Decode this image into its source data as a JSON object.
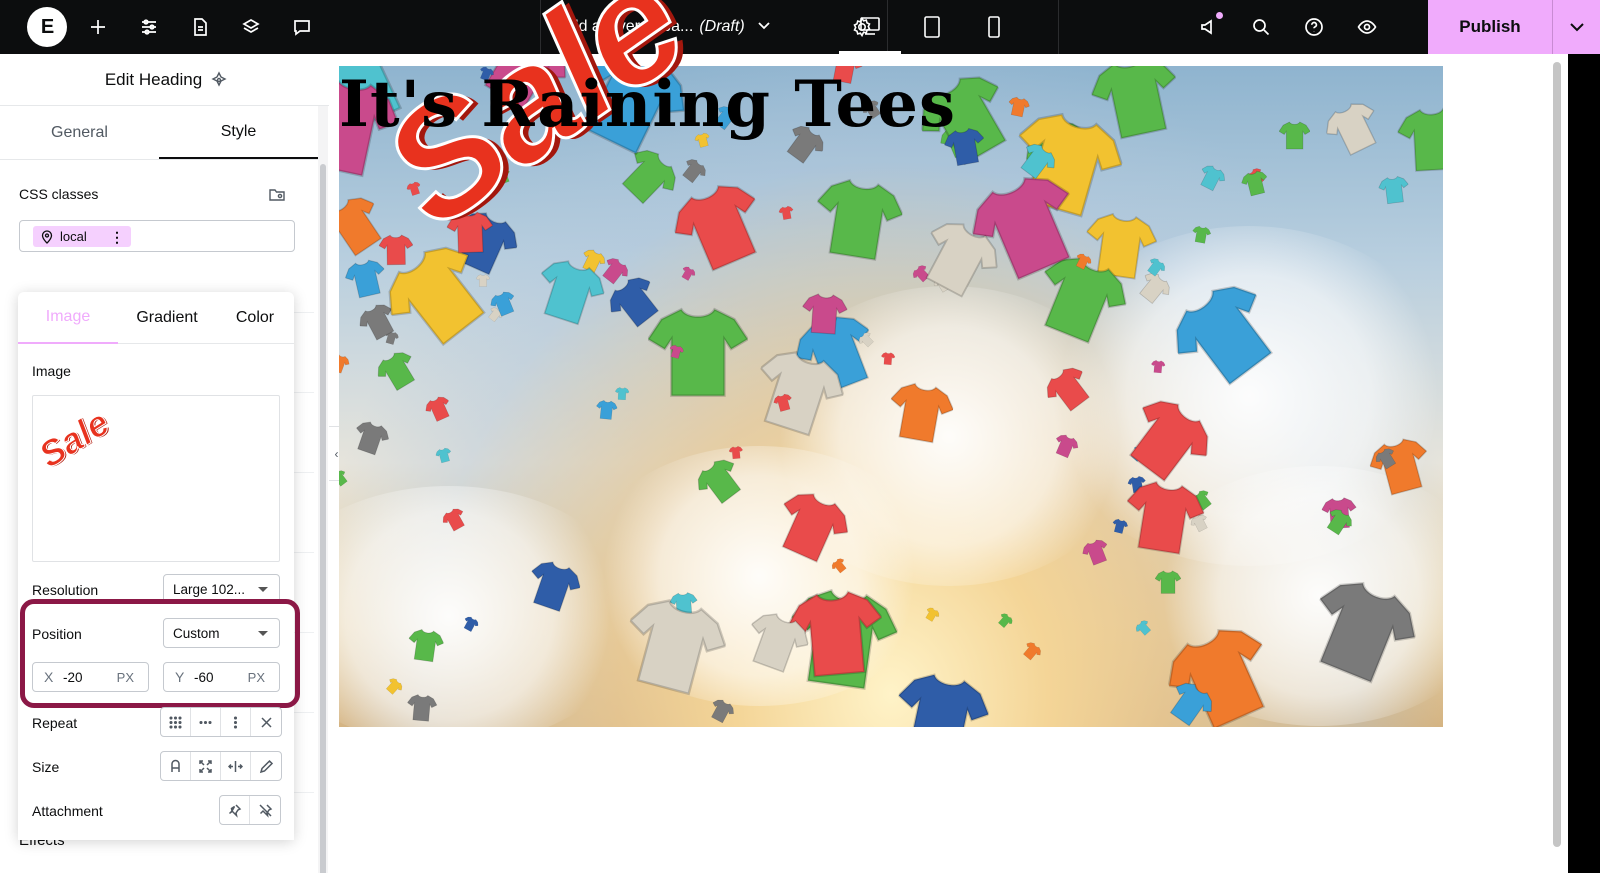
{
  "topbar": {
    "document_title": "Add a layered ba...",
    "document_status": "(Draft)",
    "publish_label": "Publish"
  },
  "panel": {
    "header_title": "Edit Heading",
    "tabs": [
      {
        "label": "General",
        "active": false
      },
      {
        "label": "Style",
        "active": true
      }
    ],
    "css_classes_label": "CSS classes",
    "css_chip_label": "local",
    "effects_label": "Effects"
  },
  "background_popover": {
    "tabs": [
      {
        "label": "Image",
        "active": true
      },
      {
        "label": "Gradient",
        "active": false
      },
      {
        "label": "Color",
        "active": false
      }
    ],
    "image_label": "Image",
    "preview_text": "Sale",
    "resolution_label": "Resolution",
    "resolution_value": "Large 102...",
    "position_label": "Position",
    "position_value": "Custom",
    "x_axis": "X",
    "x_value": "-20",
    "x_unit": "PX",
    "y_axis": "Y",
    "y_value": "-60",
    "y_unit": "PX",
    "repeat_label": "Repeat",
    "size_label": "Size",
    "attachment_label": "Attachment"
  },
  "canvas": {
    "heading": "It's Raining Tees",
    "sale_overlay": "Sale"
  },
  "colors": {
    "accent": "#f0abfc",
    "highlight_border": "#8b1846",
    "sale_red": "#e8321e",
    "topbar_bg": "#0c0d0e"
  }
}
